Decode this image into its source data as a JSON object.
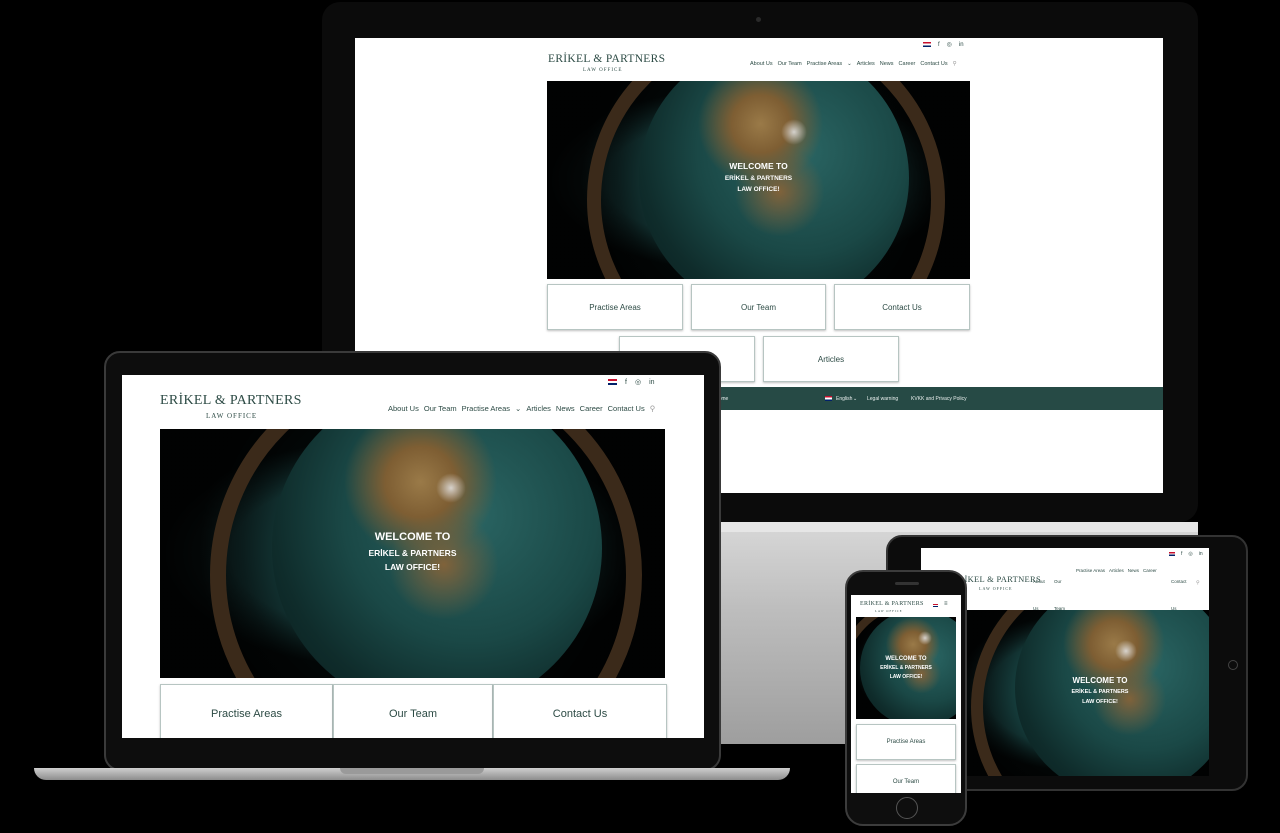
{
  "site": {
    "logo_name": "ERİKEL & PARTNERS",
    "logo_sub": "LAW OFFICE",
    "nav": {
      "about": "About Us",
      "team": "Our Team",
      "practise": "Practise Areas",
      "practise_caret": "⌄",
      "articles": "Articles",
      "news": "News",
      "career": "Career",
      "contact": "Contact Us"
    },
    "icons": {
      "flag": "uk-flag-icon",
      "facebook": "f",
      "instagram": "◎",
      "linkedin": "in",
      "search": "⚲"
    },
    "hero": {
      "line1": "WELCOME TO",
      "line2": "ERİKEL & PARTNERS",
      "line3": "LAW OFFICE!"
    },
    "boxes": {
      "practise": "Practise Areas",
      "team": "Our Team",
      "contact": "Contact Us",
      "articles": "Articles"
    },
    "footer": {
      "left": "Home",
      "language": "English",
      "language_caret": "⌄",
      "legal": "Legal warning",
      "privacy": "KVKK and Privacy Policy"
    },
    "colors": {
      "brand": "#2d4b45",
      "footer_bg": "#264a45",
      "device_frame": "#0b0b0b"
    }
  },
  "tablet_nav": {
    "about_l1": "About",
    "about_l2": "Us",
    "team_l1": "Our",
    "team_l2": "Team",
    "practise": "Practise Areas",
    "articles": "Articles",
    "news": "News",
    "career": "Career",
    "contact_l1": "Contact",
    "contact_l2": "Us"
  }
}
